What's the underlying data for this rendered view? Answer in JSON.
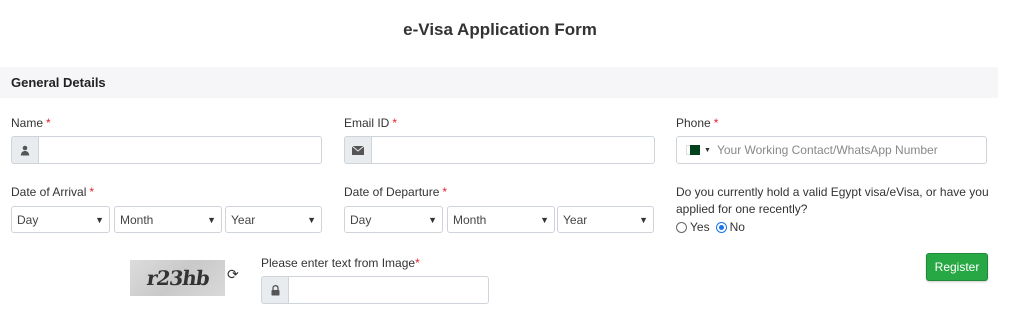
{
  "page": {
    "title": "e-Visa Application Form"
  },
  "section": {
    "title": "General Details"
  },
  "name": {
    "label": "Name",
    "required_mark": "*",
    "icon": "user-icon",
    "value": ""
  },
  "email": {
    "label": "Email ID",
    "required_mark": "*",
    "icon": "envelope-icon",
    "value": ""
  },
  "phone": {
    "label": "Phone",
    "required_mark": "*",
    "flag": "pakistan-flag-icon",
    "placeholder": "Your Working Contact/WhatsApp Number",
    "value": ""
  },
  "arrival": {
    "label": "Date of Arrival",
    "required_mark": "*",
    "day": "Day",
    "month": "Month",
    "year": "Year"
  },
  "departure": {
    "label": "Date of Departure",
    "required_mark": "*",
    "day": "Day",
    "month": "Month",
    "year": "Year"
  },
  "visa_question": {
    "text": "Do you currently hold a valid Egypt visa/eVisa, or have you applied for one recently?",
    "options": [
      "Yes",
      "No"
    ],
    "selected": "No"
  },
  "captcha": {
    "image_text": "r23hb",
    "label": "Please enter text from Image",
    "required_mark": "*",
    "value": ""
  },
  "actions": {
    "register_label": "Register"
  },
  "colors": {
    "accent_green": "#28a745",
    "required_red": "#e2232f",
    "radio_blue": "#1a73e8",
    "section_bg": "#f6f6f8"
  }
}
